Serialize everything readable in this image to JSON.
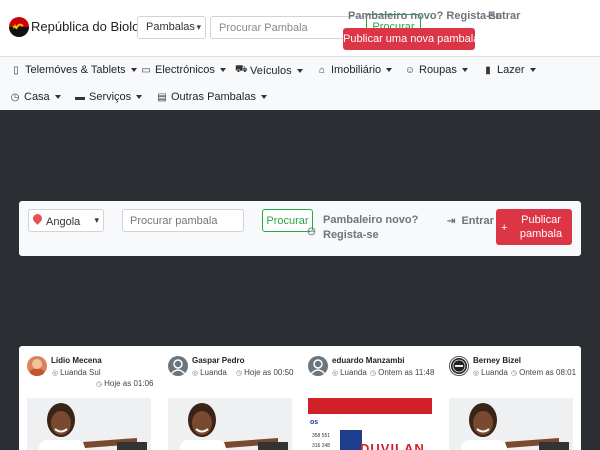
{
  "header": {
    "brand": "República do Biolo",
    "category_select": "Pambalas",
    "search_placeholder": "Procurar Pambala",
    "search_button": "Procurar",
    "register_link": "Pambaleiro novo? Regista-se",
    "login_link": "Entrar",
    "publish_button": "Publicar uma nova pambala",
    "accent_color": "#dc3545"
  },
  "nav": {
    "items": [
      {
        "label": "Telemóves & Tablets",
        "icon": "phone-icon"
      },
      {
        "label": "Electrónicos",
        "icon": "monitor-icon"
      },
      {
        "label": "Veículos",
        "icon": "truck-icon"
      },
      {
        "label": "Imobiliário",
        "icon": "home-icon"
      },
      {
        "label": "Roupas",
        "icon": "tshirt-icon"
      },
      {
        "label": "Lazer",
        "icon": "book-icon"
      },
      {
        "label": "Casa",
        "icon": "clock-icon"
      },
      {
        "label": "Serviços",
        "icon": "toolbox-icon"
      },
      {
        "label": "Outras Pambalas",
        "icon": "clipboard-icon"
      }
    ]
  },
  "hero": {
    "location": "Angola",
    "search_placeholder": "Procurar pambala",
    "search_button": "Procurar",
    "register_line1": "Pambaleiro novo?",
    "register_line2": "Regista-se",
    "login": "Entrar",
    "publish_line1": "Publicar",
    "publish_line2": "pambala"
  },
  "listings": [
    {
      "seller": "Lídio Mecena",
      "location": "Luanda Sul",
      "time": "Hoje as 01:06"
    },
    {
      "seller": "Gaspar Pedro",
      "location": "Luanda",
      "time": "Hoje as 00:50"
    },
    {
      "seller": "eduardo Manzambi",
      "location": "Luanda",
      "time": "Ontem as 11:48"
    },
    {
      "seller": "Berney Bizel",
      "location": "Luanda",
      "time": "Ontem as 08:01"
    }
  ],
  "flyer": {
    "line1": "os",
    "phone1": "358 551",
    "phone2": "316 248",
    "logo_text": "DUVILAN"
  }
}
